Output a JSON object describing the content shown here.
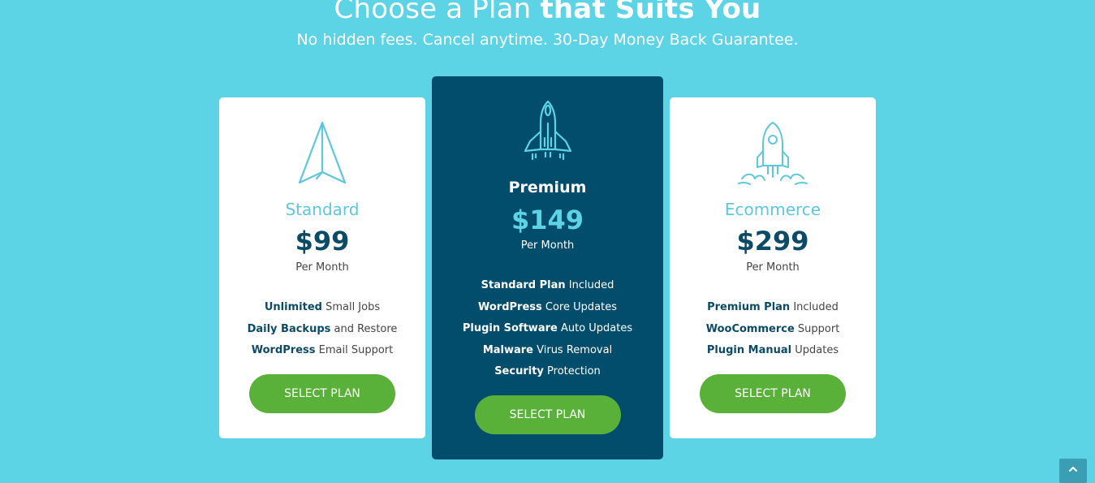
{
  "header": {
    "title_light": "Choose a Plan ",
    "title_bold": "that Suits You",
    "subtitle": "No hidden fees. Cancel anytime. 30-Day Money Back Guarantee."
  },
  "colors": {
    "background": "#5dd3e6",
    "dark_card": "#024d6b",
    "button": "#59b13a",
    "accent": "#5dc8db",
    "navy_text": "#0b4b67"
  },
  "plans": [
    {
      "icon": "paper-plane-icon",
      "name": "Standard",
      "price": "$99",
      "period": "Per Month",
      "features": [
        {
          "bold": "Unlimited",
          "rest": " Small Jobs"
        },
        {
          "bold": "Daily Backups",
          "rest": " and Restore"
        },
        {
          "bold": "WordPress",
          "rest": " Email Support"
        }
      ],
      "button": "SELECT PLAN"
    },
    {
      "icon": "rocket-icon",
      "name": "Premium",
      "price": "$149",
      "period": "Per Month",
      "features": [
        {
          "bold": "Standard Plan",
          "rest": " Included"
        },
        {
          "bold": "WordPress",
          "rest": " Core Updates"
        },
        {
          "bold": "Plugin Software",
          "rest": " Auto Updates"
        },
        {
          "bold": "Malware",
          "rest": " Virus Removal"
        },
        {
          "bold": "Security",
          "rest": " Protection"
        }
      ],
      "button": "SELECT PLAN"
    },
    {
      "icon": "rocket-launch-icon",
      "name": "Ecommerce",
      "price": "$299",
      "period": "Per Month",
      "features": [
        {
          "bold": "Premium Plan",
          "rest": " Included"
        },
        {
          "bold": "WooCommerce",
          "rest": " Support"
        },
        {
          "bold": "Plugin Manual",
          "rest": " Updates"
        }
      ],
      "button": "SELECT PLAN"
    }
  ],
  "scroll_top": {
    "icon": "chevron-up-icon"
  }
}
